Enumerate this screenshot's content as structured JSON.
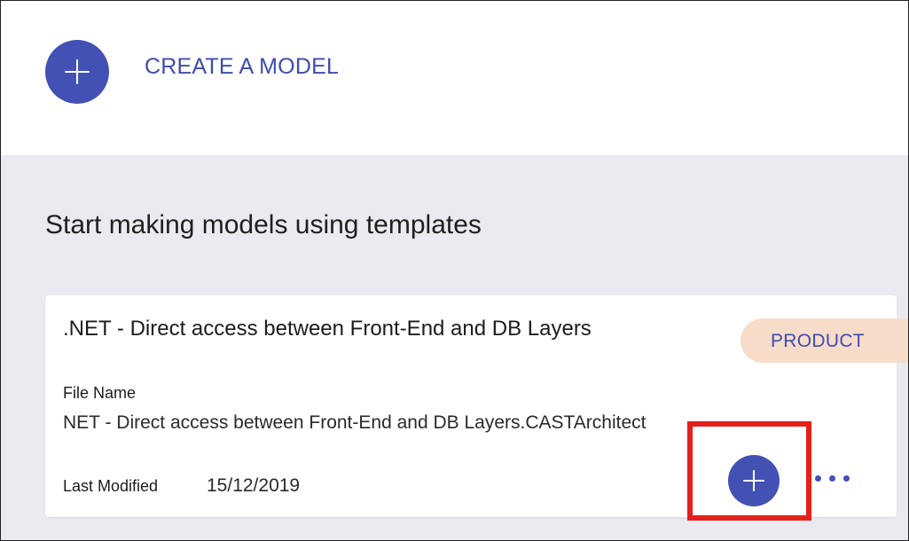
{
  "create": {
    "label": "CREATE A MODEL",
    "icon": "plus-icon"
  },
  "templates": {
    "heading": "Start making models using templates",
    "card": {
      "title": ".NET - Direct access between Front-End and DB Layers",
      "badge": "PRODUCT",
      "file_name_label": "File Name",
      "file_name_value": "NET - Direct access between Front-End and DB Layers.CASTArchitect",
      "last_modified_label": "Last Modified",
      "last_modified_value": "15/12/2019",
      "add_icon": "plus-icon",
      "more_icon": "more-horizontal-icon"
    }
  },
  "colors": {
    "accent": "#4451b4",
    "badge_bg": "#f7dcca",
    "section_bg": "#e9ebf0",
    "highlight": "#e4201c"
  }
}
